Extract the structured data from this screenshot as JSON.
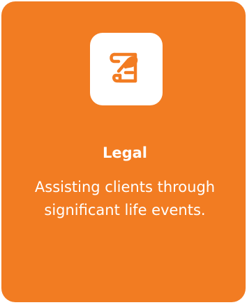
{
  "card": {
    "icon": "legal-document-quill-icon",
    "title": "Legal",
    "description": "Assisting clients through significant life events."
  },
  "colors": {
    "card_background": "#f27c22",
    "icon_tile_background": "#ffffff",
    "icon_color": "#f27c22",
    "text_color": "#ffffff"
  }
}
